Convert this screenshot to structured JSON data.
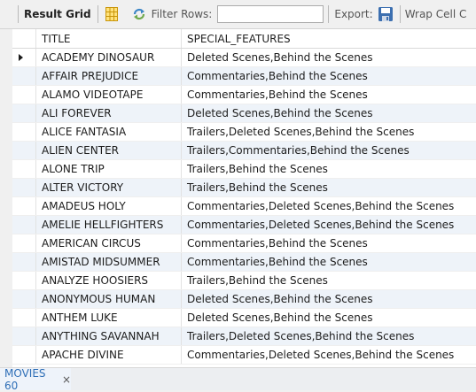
{
  "toolbar": {
    "result_grid_label": "Result Grid",
    "filter_rows_label": "Filter Rows:",
    "filter_value": "",
    "export_label": "Export:",
    "wrap_label": "Wrap Cell C",
    "accent_color": "#f5b400",
    "refresh_color": "#3d86c6"
  },
  "grid": {
    "columns": [
      "TITLE",
      "SPECIAL_FEATURES"
    ],
    "rows": [
      {
        "title": "ACADEMY DINOSAUR",
        "features": "Deleted Scenes,Behind the Scenes",
        "current": true
      },
      {
        "title": "AFFAIR PREJUDICE",
        "features": "Commentaries,Behind the Scenes"
      },
      {
        "title": "ALAMO VIDEOTAPE",
        "features": "Commentaries,Behind the Scenes"
      },
      {
        "title": "ALI FOREVER",
        "features": "Deleted Scenes,Behind the Scenes"
      },
      {
        "title": "ALICE FANTASIA",
        "features": "Trailers,Deleted Scenes,Behind the Scenes"
      },
      {
        "title": "ALIEN CENTER",
        "features": "Trailers,Commentaries,Behind the Scenes"
      },
      {
        "title": "ALONE TRIP",
        "features": "Trailers,Behind the Scenes"
      },
      {
        "title": "ALTER VICTORY",
        "features": "Trailers,Behind the Scenes"
      },
      {
        "title": "AMADEUS HOLY",
        "features": "Commentaries,Deleted Scenes,Behind the Scenes"
      },
      {
        "title": "AMELIE HELLFIGHTERS",
        "features": "Commentaries,Deleted Scenes,Behind the Scenes"
      },
      {
        "title": "AMERICAN CIRCUS",
        "features": "Commentaries,Behind the Scenes"
      },
      {
        "title": "AMISTAD MIDSUMMER",
        "features": "Commentaries,Behind the Scenes"
      },
      {
        "title": "ANALYZE HOOSIERS",
        "features": "Trailers,Behind the Scenes"
      },
      {
        "title": "ANONYMOUS HUMAN",
        "features": "Deleted Scenes,Behind the Scenes"
      },
      {
        "title": "ANTHEM LUKE",
        "features": "Deleted Scenes,Behind the Scenes"
      },
      {
        "title": "ANYTHING SAVANNAH",
        "features": "Trailers,Deleted Scenes,Behind the Scenes"
      },
      {
        "title": "APACHE DIVINE",
        "features": "Commentaries,Deleted Scenes,Behind the Scenes"
      }
    ]
  },
  "tabs": [
    {
      "label": "MOVIES 60",
      "close": "×"
    }
  ]
}
